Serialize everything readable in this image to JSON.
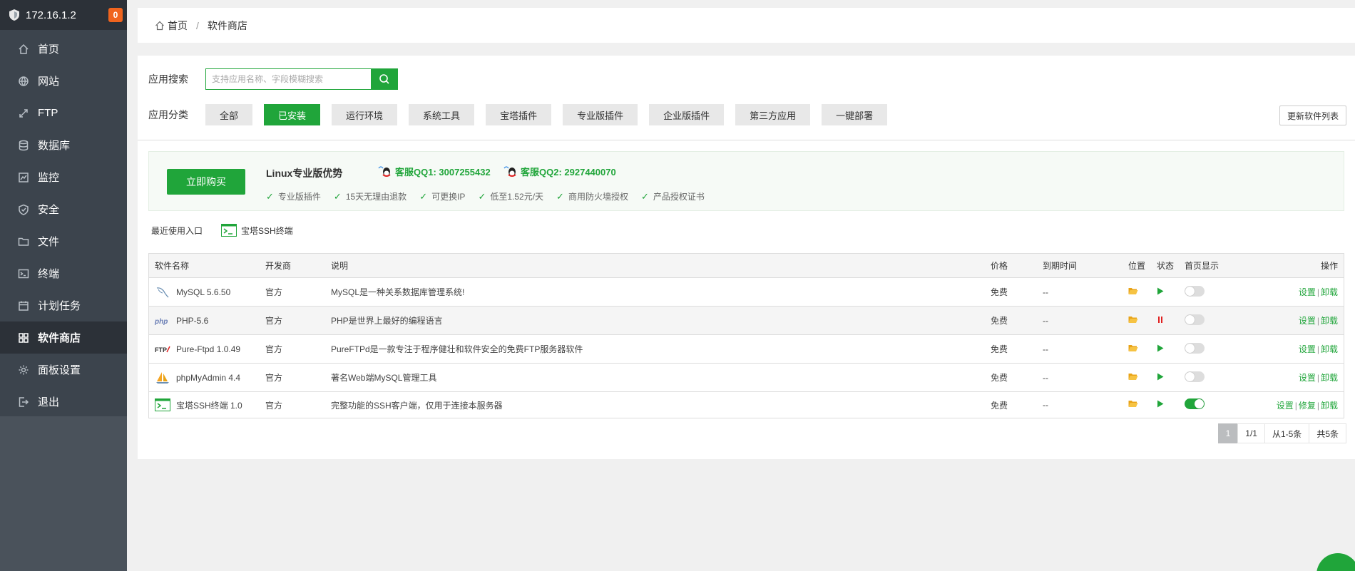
{
  "sidebar": {
    "ip": "172.16.1.2",
    "badge": "0",
    "items": [
      {
        "label": "首页",
        "icon": "home-icon"
      },
      {
        "label": "网站",
        "icon": "globe-icon"
      },
      {
        "label": "FTP",
        "icon": "ftp-icon"
      },
      {
        "label": "数据库",
        "icon": "database-icon"
      },
      {
        "label": "监控",
        "icon": "monitor-icon"
      },
      {
        "label": "安全",
        "icon": "shield-icon"
      },
      {
        "label": "文件",
        "icon": "folder-icon"
      },
      {
        "label": "终端",
        "icon": "terminal-icon"
      },
      {
        "label": "计划任务",
        "icon": "calendar-icon"
      },
      {
        "label": "软件商店",
        "icon": "grid-icon"
      },
      {
        "label": "面板设置",
        "icon": "gear-icon"
      },
      {
        "label": "退出",
        "icon": "logout-icon"
      }
    ]
  },
  "breadcrumb": {
    "home": "首页",
    "separator": "/",
    "current": "软件商店"
  },
  "search": {
    "label": "应用搜索",
    "placeholder": "支持应用名称、字段模糊搜索"
  },
  "category": {
    "label": "应用分类",
    "items": [
      "全部",
      "已安装",
      "运行环境",
      "系统工具",
      "宝塔插件",
      "专业版插件",
      "企业版插件",
      "第三方应用",
      "一键部署"
    ],
    "active": "已安装",
    "refresh": "更新软件列表"
  },
  "promo": {
    "buy": "立即购买",
    "title": "Linux专业版优势",
    "qq1": "客服QQ1: 3007255432",
    "qq2": "客服QQ2: 2927440070",
    "features": [
      "专业版插件",
      "15天无理由退款",
      "可更换IP",
      "低至1.52元/天",
      "商用防火墙授权",
      "产品授权证书"
    ]
  },
  "recent": {
    "label": "最近使用入口",
    "item": "宝塔SSH终端"
  },
  "table": {
    "headers": [
      "软件名称",
      "开发商",
      "说明",
      "价格",
      "到期时间",
      "位置",
      "状态",
      "首页显示",
      "操作"
    ],
    "rows": [
      {
        "name": "MySQL 5.6.50",
        "dev": "官方",
        "desc": "MySQL是一种关系数据库管理系统!",
        "price": "免费",
        "expire": "--",
        "status": "running",
        "home": false,
        "ops": [
          "设置",
          "卸载"
        ]
      },
      {
        "name": "PHP-5.6",
        "dev": "官方",
        "desc": "PHP是世界上最好的编程语言",
        "price": "免费",
        "expire": "--",
        "status": "stopped",
        "home": false,
        "ops": [
          "设置",
          "卸载"
        ]
      },
      {
        "name": "Pure-Ftpd 1.0.49",
        "dev": "官方",
        "desc": "PureFTPd是一款专注于程序健壮和软件安全的免费FTP服务器软件",
        "price": "免费",
        "expire": "--",
        "status": "running",
        "home": false,
        "ops": [
          "设置",
          "卸载"
        ]
      },
      {
        "name": "phpMyAdmin 4.4",
        "dev": "官方",
        "desc": "著名Web端MySQL管理工具",
        "price": "免费",
        "expire": "--",
        "status": "running",
        "home": false,
        "ops": [
          "设置",
          "卸载"
        ]
      },
      {
        "name": "宝塔SSH终端 1.0",
        "dev": "官方",
        "desc": "完整功能的SSH客户端，仅用于连接本服务器",
        "price": "免费",
        "expire": "--",
        "status": "running",
        "home": true,
        "ops": [
          "设置",
          "修复",
          "卸载"
        ]
      }
    ]
  },
  "pager": {
    "current": "1",
    "pages": "1/1",
    "range": "从1-5条",
    "total": "共5条"
  },
  "colors": {
    "accent": "#20a53a",
    "sidebar": "#3c444d",
    "badge": "#f0641e",
    "stop": "#e02020"
  }
}
